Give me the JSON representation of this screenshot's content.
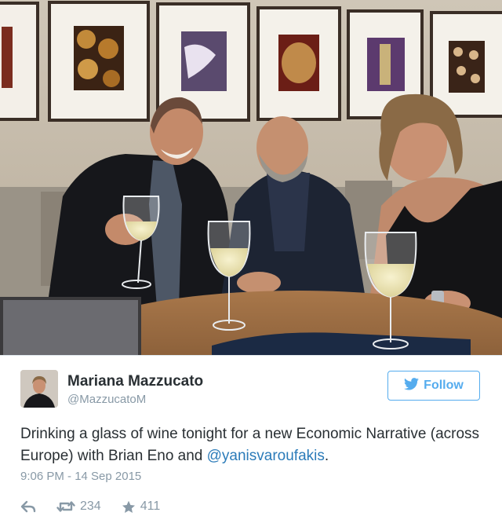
{
  "tweet": {
    "author_name": "Mariana Mazzucato",
    "author_handle": "@MazzucatoM",
    "follow_label": "Follow",
    "text_before_mention": "Drinking a glass of wine tonight for a new Economic Narrative (across Europe) with Brian Eno and ",
    "mention": "@yanisvaroufakis",
    "text_after_mention": ".",
    "timestamp": "9:06 PM - 14 Sep 2015",
    "retweet_count": "234",
    "like_count": "411"
  },
  "icons": {
    "follow": "twitter-bird-icon",
    "reply": "reply-icon",
    "retweet": "retweet-icon",
    "like": "star-icon"
  },
  "colors": {
    "accent": "#55acee",
    "link": "#2b7bb9",
    "muted": "#8899a6",
    "text": "#292f33"
  }
}
